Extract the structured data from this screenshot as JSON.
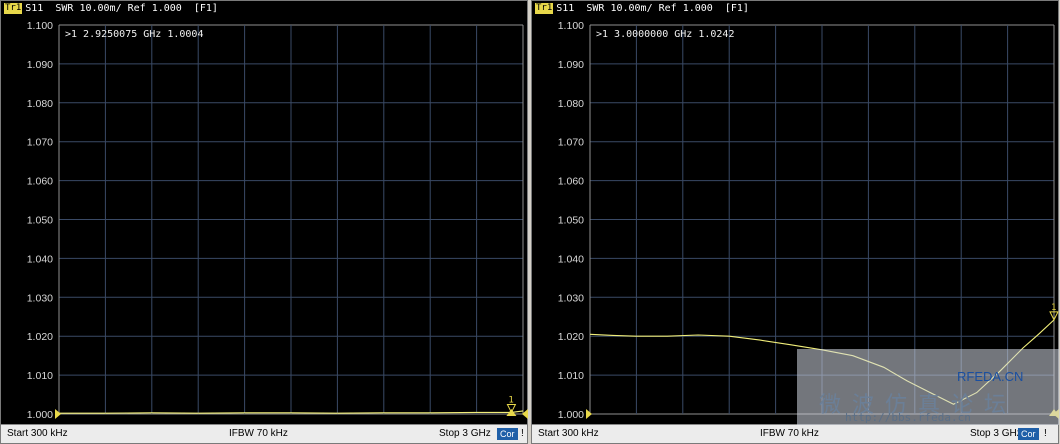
{
  "panels": [
    {
      "trace_badge": "Tr1",
      "header": "S11  SWR 10.00m/ Ref 1.000  [F1]",
      "marker_readout": ">1   2.9250075 GHz  1.0004",
      "marker_id": "1",
      "footer": {
        "start": "Start 300 kHz",
        "ifbw": "IFBW 70 kHz",
        "stop": "Stop 3 GHz",
        "cor": "Cor",
        "bang": "!"
      }
    },
    {
      "trace_badge": "Tr1",
      "header": "S11  SWR 10.00m/ Ref 1.000  [F1]",
      "marker_readout": ">1   3.0000000 GHz  1.0242",
      "marker_id": "1",
      "footer": {
        "start": "Start 300 kHz",
        "ifbw": "IFBW 70 kHz",
        "stop": "Stop 3 GHz",
        "cor": "Cor",
        "bang": "!"
      }
    }
  ],
  "watermark": {
    "line1": "RFEDA.CN",
    "line2": "微 波 仿 真 论 坛",
    "line3": "http://bbs.rfeda.cn"
  },
  "colors": {
    "trace": "#f2ef7a",
    "grid": "#3a4a66",
    "frame": "#909090",
    "marker": "#e8d84a"
  },
  "chart_data": [
    {
      "type": "line",
      "ylim": [
        1.0,
        1.1
      ],
      "yticks": [
        "1.100",
        "1.090",
        "1.080",
        "1.070",
        "1.060",
        "1.050",
        "1.040",
        "1.030",
        "1.020",
        "1.010",
        "1.000"
      ],
      "xlim_ghz": [
        0.0003,
        3.0
      ],
      "series": [
        {
          "x": [
            0.0003,
            0.3,
            0.6,
            0.9,
            1.2,
            1.5,
            1.8,
            2.1,
            2.4,
            2.7,
            2.925,
            3.0
          ],
          "y": [
            1.0002,
            1.0002,
            1.0003,
            1.0002,
            1.0003,
            1.0003,
            1.0002,
            1.0003,
            1.0003,
            1.0004,
            1.0004,
            1.0008
          ]
        }
      ],
      "marker": {
        "x": 2.9250075,
        "y": 1.0004
      }
    },
    {
      "type": "line",
      "ylim": [
        1.0,
        1.1
      ],
      "yticks": [
        "1.100",
        "1.090",
        "1.080",
        "1.070",
        "1.060",
        "1.050",
        "1.040",
        "1.030",
        "1.020",
        "1.010",
        "1.000"
      ],
      "xlim_ghz": [
        0.0003,
        3.0
      ],
      "series": [
        {
          "x": [
            0.0003,
            0.15,
            0.3,
            0.5,
            0.7,
            0.9,
            1.1,
            1.3,
            1.5,
            1.7,
            1.9,
            2.05,
            2.2,
            2.35,
            2.5,
            2.65,
            2.8,
            2.9,
            3.0
          ],
          "y": [
            1.0205,
            1.0202,
            1.02,
            1.02,
            1.0203,
            1.02,
            1.019,
            1.0178,
            1.0165,
            1.015,
            1.012,
            1.0085,
            1.0055,
            1.0025,
            1.0055,
            1.011,
            1.017,
            1.0205,
            1.0242
          ]
        }
      ],
      "marker": {
        "x": 3.0,
        "y": 1.0242
      }
    }
  ]
}
